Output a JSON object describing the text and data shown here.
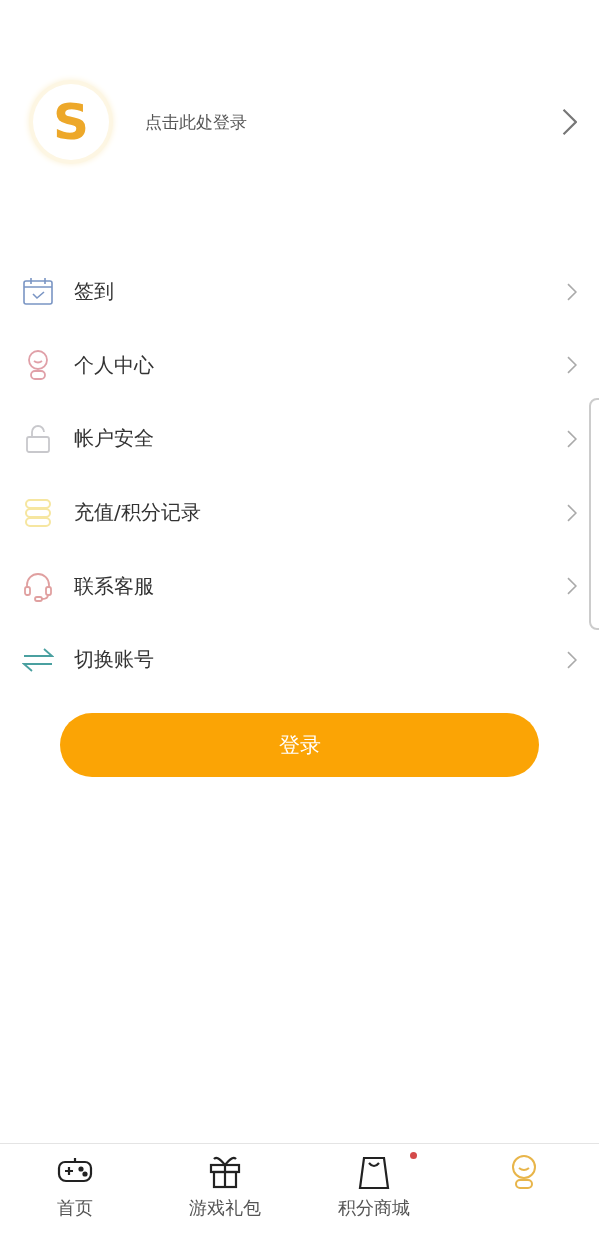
{
  "profile": {
    "avatar_letter": "S",
    "login_prompt": "点击此处登录"
  },
  "menu": [
    {
      "kind": "calendar",
      "label": "签到"
    },
    {
      "kind": "person",
      "label": "个人中心"
    },
    {
      "kind": "lock",
      "label": "帐户安全"
    },
    {
      "kind": "coins",
      "label": "充值/积分记录"
    },
    {
      "kind": "headset",
      "label": "联系客服"
    },
    {
      "kind": "switch",
      "label": "切换账号"
    }
  ],
  "login_button": "登录",
  "tabs": [
    {
      "kind": "gamepad",
      "label": "首页",
      "selected": false,
      "badge": false
    },
    {
      "kind": "gift",
      "label": "游戏礼包",
      "selected": false,
      "badge": false
    },
    {
      "kind": "bag",
      "label": "积分商城",
      "selected": false,
      "badge": true
    },
    {
      "kind": "person",
      "selected": true,
      "badge": false
    }
  ]
}
